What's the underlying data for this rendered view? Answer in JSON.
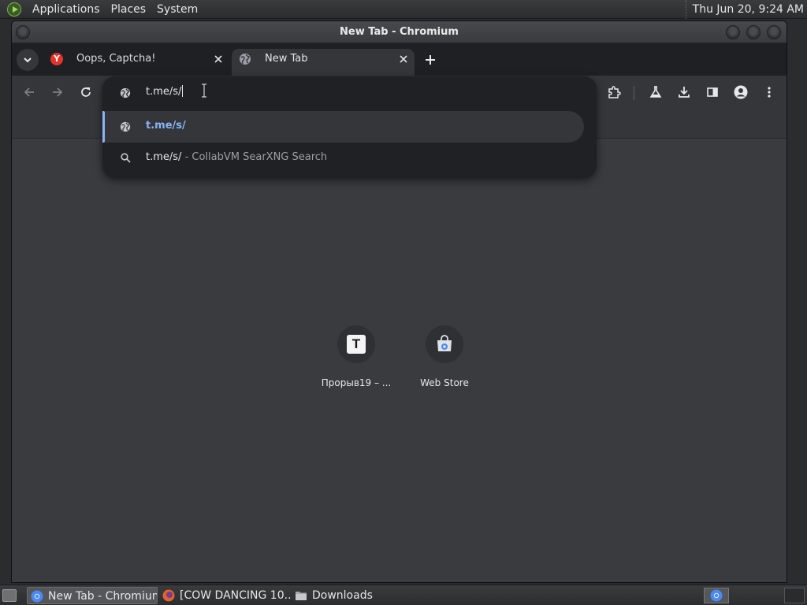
{
  "top_panel": {
    "menus": [
      "Applications",
      "Places",
      "System"
    ],
    "clock": "Thu Jun 20,  9:24 AM"
  },
  "window": {
    "title": "New Tab - Chromium"
  },
  "tabs": [
    {
      "title": "Oops, Captcha!",
      "favicon": "Y",
      "active": false
    },
    {
      "title": "New Tab",
      "favicon": "globe-icon",
      "active": true
    }
  ],
  "omnibox": {
    "input_value": "t.me/s/",
    "suggestions": [
      {
        "type": "url",
        "text": "t.me/s/"
      },
      {
        "type": "search",
        "query": "t.me/s/",
        "suffix": " - CollabVM SearXNG Search"
      }
    ]
  },
  "shortcuts": [
    {
      "title": "Прорыв19 – ...",
      "icon_letter": "T"
    },
    {
      "title": "Web Store",
      "icon": "web-store-icon"
    }
  ],
  "taskbar": {
    "tasks": [
      {
        "label": "New Tab - Chromium",
        "active": true
      },
      {
        "label": "[COW DANCING 10...",
        "active": false
      },
      {
        "label": "Downloads",
        "active": false
      }
    ]
  },
  "colors": {
    "accent": "#8ab4f8",
    "toolbar": "#35363a",
    "content_bg": "#3a3b3f",
    "popup_bg": "#202124"
  }
}
